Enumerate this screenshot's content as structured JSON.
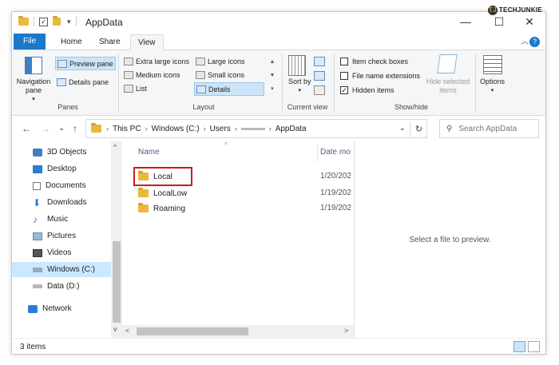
{
  "window": {
    "title": "AppData",
    "brand": "TECHJUNKIE",
    "brand_badge": "TJ",
    "minimize_label": "—",
    "maximize_label": "☐",
    "close_label": "✕",
    "quick_access_dropdown": "▾"
  },
  "tabs": {
    "file": "File",
    "home": "Home",
    "share": "Share",
    "view": "View",
    "collapse": "︿",
    "help": "?"
  },
  "ribbon": {
    "panes": {
      "navigation_pane": "Navigation pane",
      "navigation_pane_arrow": "▾",
      "preview_pane": "Preview pane",
      "details_pane": "Details pane",
      "label": "Panes"
    },
    "layout": {
      "extra_large_icons": "Extra large icons",
      "large_icons": "Large icons",
      "medium_icons": "Medium icons",
      "small_icons": "Small icons",
      "list": "List",
      "details": "Details",
      "label": "Layout"
    },
    "current_view": {
      "sort_by": "Sort by",
      "sort_arrow": "▾",
      "label": "Current view"
    },
    "show_hide": {
      "item_check_boxes": "Item check boxes",
      "file_name_extensions": "File name extensions",
      "hidden_items": "Hidden items",
      "hide_selected_items": "Hide selected items",
      "label": "Show/hide"
    },
    "options": {
      "label": "Options",
      "arrow": "▾"
    }
  },
  "address": {
    "back": "←",
    "forward": "→",
    "recent": "⌄",
    "up": "↑",
    "crumbs": [
      "This PC",
      "Windows (C:)",
      "Users",
      "AppData"
    ],
    "dropdown": "⌄",
    "refresh": "↻",
    "search_placeholder": "Search AppData"
  },
  "sidebar": {
    "items": [
      {
        "label": "3D Objects",
        "icon": "3d-objects-icon"
      },
      {
        "label": "Desktop",
        "icon": "desktop-icon"
      },
      {
        "label": "Documents",
        "icon": "documents-icon"
      },
      {
        "label": "Downloads",
        "icon": "downloads-icon"
      },
      {
        "label": "Music",
        "icon": "music-icon"
      },
      {
        "label": "Pictures",
        "icon": "pictures-icon"
      },
      {
        "label": "Videos",
        "icon": "videos-icon"
      },
      {
        "label": "Windows (C:)",
        "icon": "drive-c-icon",
        "selected": true
      },
      {
        "label": "Data (D:)",
        "icon": "drive-d-icon"
      },
      {
        "label": "Network",
        "icon": "network-icon"
      }
    ],
    "scroll_up": "^",
    "scroll_down": "v"
  },
  "files": {
    "columns": {
      "name": "Name",
      "date": "Date mo",
      "sort_indicator": "^"
    },
    "rows": [
      {
        "name": "Local",
        "date": "1/20/202",
        "highlighted": true
      },
      {
        "name": "LocalLow",
        "date": "1/19/202"
      },
      {
        "name": "Roaming",
        "date": "1/19/202"
      }
    ],
    "scroll_left": "<",
    "scroll_right": ">"
  },
  "preview": {
    "message": "Select a file to preview."
  },
  "status": {
    "item_count": "3 items"
  },
  "colors": {
    "accent": "#1979ca",
    "folder": "#e8b93c",
    "selection": "#cce8ff",
    "highlight_border": "#d11a1a"
  }
}
